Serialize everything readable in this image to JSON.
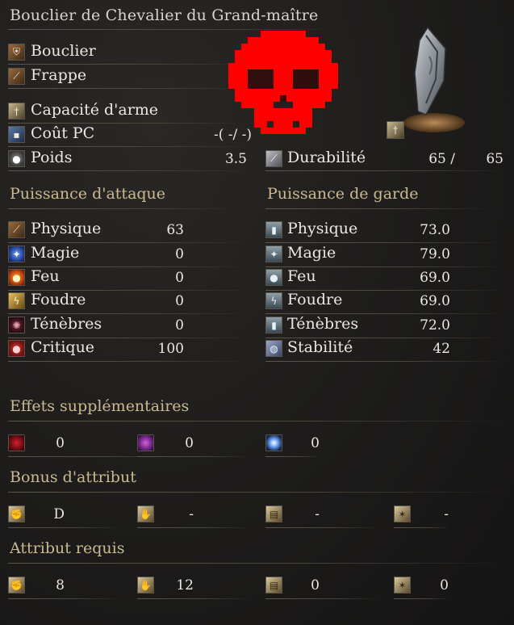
{
  "title": "Bouclier de Chevalier du Grand-maître",
  "item": {
    "type": "Bouclier",
    "attack_type": "Frappe",
    "skill_label": "Capacité d'arme",
    "fp_label": "Coût PC",
    "fp_value": "-(   -/   -)",
    "weight_label": "Poids",
    "weight_value": "3.5",
    "durability_label": "Durabilité",
    "durability_current": "65 /",
    "durability_max": "65"
  },
  "attack": {
    "header": "Puissance d'attaque",
    "rows": [
      {
        "label": "Physique",
        "value": "63",
        "icon": "physical-icon"
      },
      {
        "label": "Magie",
        "value": "0",
        "icon": "magic-icon"
      },
      {
        "label": "Feu",
        "value": "0",
        "icon": "fire-icon"
      },
      {
        "label": "Foudre",
        "value": "0",
        "icon": "lightning-icon"
      },
      {
        "label": "Ténèbres",
        "value": "0",
        "icon": "dark-icon"
      },
      {
        "label": "Critique",
        "value": "100",
        "icon": "critical-icon"
      }
    ]
  },
  "guard": {
    "header": "Puissance de garde",
    "rows": [
      {
        "label": "Physique",
        "value": "73.0",
        "icon": "guard-physical-icon"
      },
      {
        "label": "Magie",
        "value": "79.0",
        "icon": "guard-magic-icon"
      },
      {
        "label": "Feu",
        "value": "69.0",
        "icon": "guard-fire-icon"
      },
      {
        "label": "Foudre",
        "value": "69.0",
        "icon": "guard-lightning-icon"
      },
      {
        "label": "Ténèbres",
        "value": "72.0",
        "icon": "guard-dark-icon"
      },
      {
        "label": "Stabilité",
        "value": "42",
        "icon": "stability-icon"
      }
    ]
  },
  "effects": {
    "header": "Effets supplémentaires",
    "items": [
      {
        "icon": "bleed-icon",
        "value": "0"
      },
      {
        "icon": "poison-icon",
        "value": "0"
      },
      {
        "icon": "frost-icon",
        "value": "0"
      }
    ]
  },
  "bonus": {
    "header": "Bonus d'attribut",
    "items": [
      {
        "icon": "strength-icon",
        "value": "D"
      },
      {
        "icon": "dexterity-icon",
        "value": "-"
      },
      {
        "icon": "intelligence-icon",
        "value": "-"
      },
      {
        "icon": "faith-icon",
        "value": "-"
      }
    ]
  },
  "requirements": {
    "header": "Attribut requis",
    "items": [
      {
        "icon": "strength-icon",
        "value": "8"
      },
      {
        "icon": "dexterity-icon",
        "value": "12"
      },
      {
        "icon": "intelligence-icon",
        "value": "0"
      },
      {
        "icon": "faith-icon",
        "value": "0"
      }
    ]
  },
  "colors": {
    "header_gold": "#cbb98f",
    "skull_red": "#ff0000",
    "text": "#ece8e0"
  }
}
